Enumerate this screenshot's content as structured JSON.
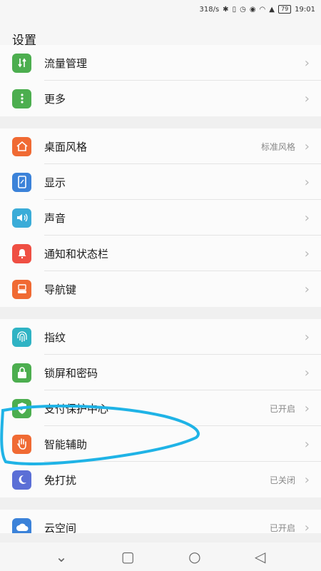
{
  "status_bar": {
    "speed": "318/s",
    "battery": "79",
    "time": "19:01"
  },
  "header": {
    "title": "设置"
  },
  "groups": [
    {
      "items": [
        {
          "name": "traffic",
          "label": "流量管理",
          "value": "",
          "icon": "traffic-icon",
          "color": "#4cae4f"
        },
        {
          "name": "more",
          "label": "更多",
          "value": "",
          "icon": "more-icon",
          "color": "#4cae4f"
        }
      ]
    },
    {
      "items": [
        {
          "name": "desktop",
          "label": "桌面风格",
          "value": "标准风格",
          "icon": "home-icon",
          "color": "#f06a33"
        },
        {
          "name": "display",
          "label": "显示",
          "value": "",
          "icon": "display-icon",
          "color": "#3b82d9"
        },
        {
          "name": "sound",
          "label": "声音",
          "value": "",
          "icon": "speaker-icon",
          "color": "#3aacd8"
        },
        {
          "name": "notify",
          "label": "通知和状态栏",
          "value": "",
          "icon": "bell-icon",
          "color": "#ef4f43"
        },
        {
          "name": "navkey",
          "label": "导航键",
          "value": "",
          "icon": "navkey-icon",
          "color": "#f06a33"
        }
      ]
    },
    {
      "items": [
        {
          "name": "fingerprint",
          "label": "指纹",
          "value": "",
          "icon": "fingerprint-icon",
          "color": "#2fb3c4"
        },
        {
          "name": "lockscreen",
          "label": "锁屏和密码",
          "value": "",
          "icon": "lock-icon",
          "color": "#4cae4f"
        },
        {
          "name": "payment",
          "label": "支付保护中心",
          "value": "已开启",
          "icon": "shield-icon",
          "color": "#4cae4f"
        },
        {
          "name": "assist",
          "label": "智能辅助",
          "value": "",
          "icon": "hand-icon",
          "color": "#f06a33"
        },
        {
          "name": "dnd",
          "label": "免打扰",
          "value": "已关闭",
          "icon": "moon-icon",
          "color": "#5b6fd6"
        }
      ]
    },
    {
      "items": [
        {
          "name": "cloud",
          "label": "云空间",
          "value": "已开启",
          "icon": "cloud-icon",
          "color": "#3b82d9"
        },
        {
          "name": "next",
          "label": "",
          "value": "",
          "icon": "partial-icon",
          "color": "#ef4f43"
        }
      ]
    }
  ]
}
